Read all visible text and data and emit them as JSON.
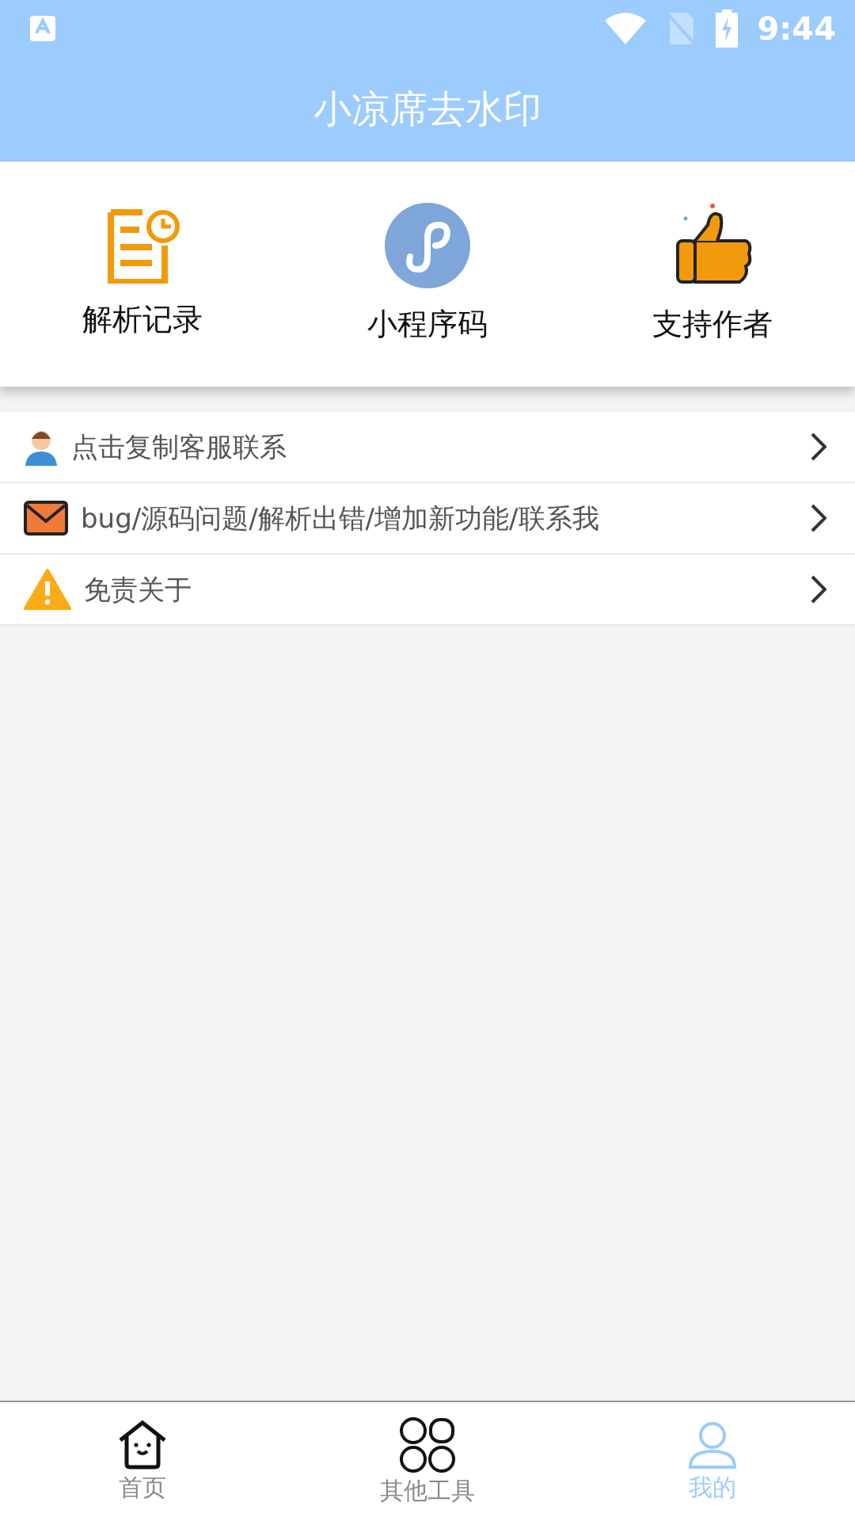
{
  "status_bar": {
    "time": "9:44"
  },
  "header": {
    "title": "小凉席去水印"
  },
  "shortcuts": [
    {
      "kind": "record",
      "label": "解析记录"
    },
    {
      "kind": "miniapp",
      "label": "小程序码"
    },
    {
      "kind": "like",
      "label": "支持作者"
    }
  ],
  "list": [
    {
      "kind": "service",
      "label": "点击复制客服联系"
    },
    {
      "kind": "mail",
      "label": "bug/源码问题/解析出错/增加新功能/联系我"
    },
    {
      "kind": "warning",
      "label": "免责关于"
    }
  ],
  "tabs": [
    {
      "kind": "home",
      "label": "首页",
      "selected": false
    },
    {
      "kind": "tools",
      "label": "其他工具",
      "selected": false
    },
    {
      "kind": "me",
      "label": "我的",
      "selected": true
    }
  ]
}
